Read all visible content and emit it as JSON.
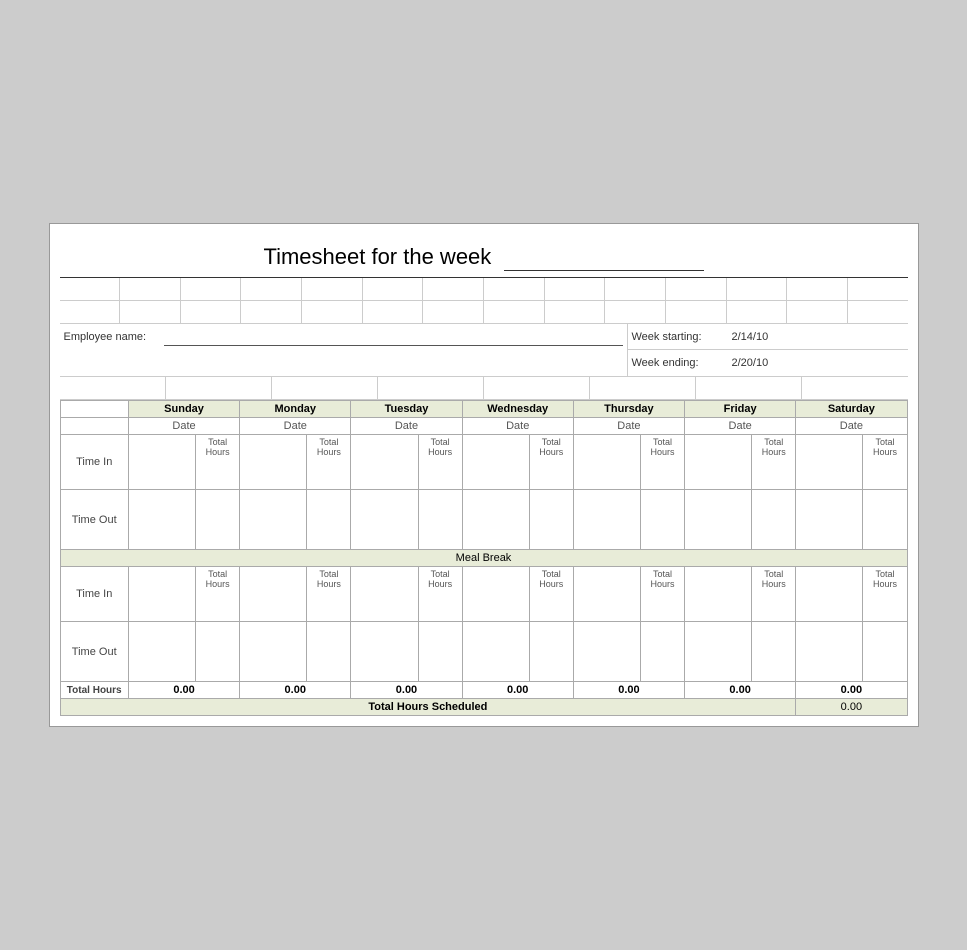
{
  "title": {
    "text": "Timesheet for the week",
    "underline": ""
  },
  "employee": {
    "label": "Employee name:",
    "value": ""
  },
  "week": {
    "starting_label": "Week starting:",
    "starting_value": "2/14/10",
    "ending_label": "Week ending:",
    "ending_value": "2/20/10"
  },
  "days": [
    "Sunday",
    "Monday",
    "Tuesday",
    "Wednesday",
    "Thursday",
    "Friday",
    "Saturday"
  ],
  "date_label": "Date",
  "labels": {
    "time_in": "Time In",
    "time_out": "Time Out",
    "total_hours": "Total Hours",
    "meal_break": "Meal Break",
    "total_hours_row": "Total Hours",
    "total_scheduled": "Total Hours Scheduled"
  },
  "sub_labels": {
    "total_hours": "Total\nHours"
  },
  "totals": [
    "0.00",
    "0.00",
    "0.00",
    "0.00",
    "0.00",
    "0.00",
    "0.00"
  ],
  "grand_total": "0.00"
}
